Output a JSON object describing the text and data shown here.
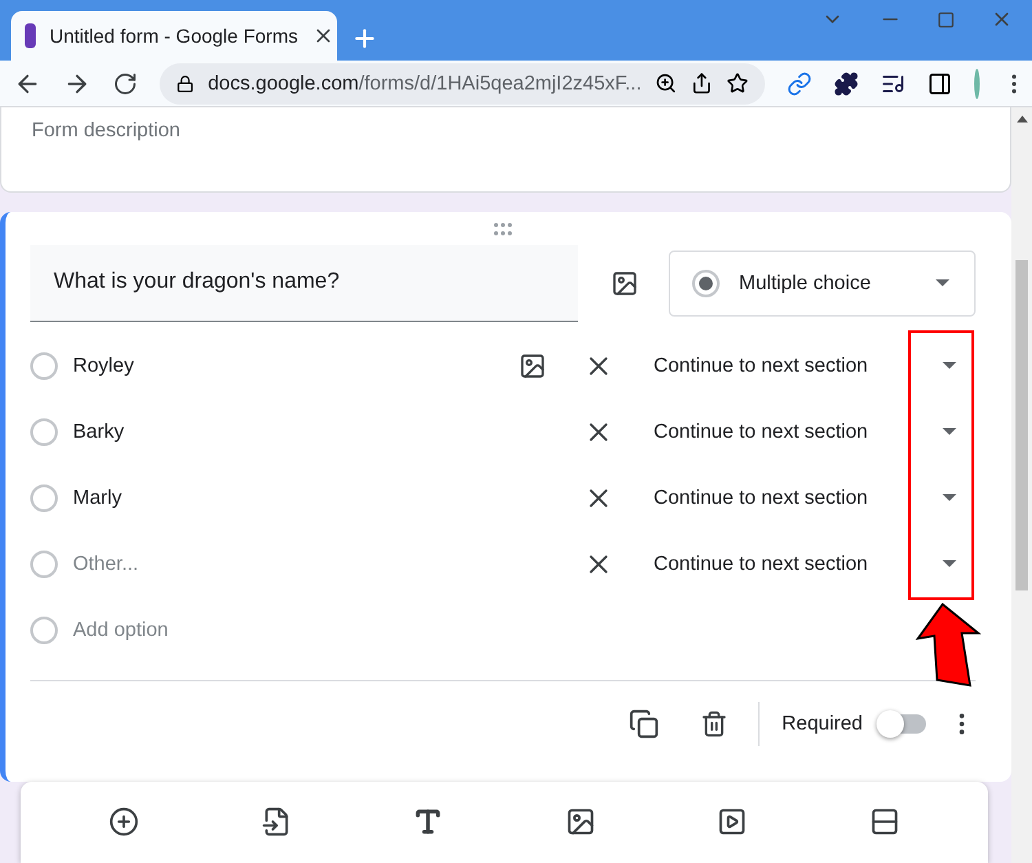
{
  "browser": {
    "tab_title": "Untitled form - Google Forms",
    "url_host": "docs.google.com",
    "url_path": "/forms/d/1HAi5qea2mjI2z45xF..."
  },
  "form": {
    "description_placeholder": "Form description"
  },
  "question": {
    "title": "What is your dragon's name?",
    "type": "Multiple choice",
    "options": [
      {
        "kind": "option",
        "label": "Royley",
        "checked": false,
        "image_button": true,
        "destination": "Continue to next section"
      },
      {
        "kind": "option",
        "label": "Barky",
        "checked": false,
        "image_button": false,
        "destination": "Continue to next section"
      },
      {
        "kind": "option",
        "label": "Marly",
        "checked": false,
        "image_button": false,
        "destination": "Continue to next section"
      },
      {
        "kind": "other",
        "label": "Other...",
        "checked": false,
        "image_button": false,
        "destination": "Continue to next section"
      },
      {
        "kind": "add",
        "label": "Add option",
        "checked": false,
        "image_button": false
      }
    ],
    "required_label": "Required",
    "required": false
  }
}
